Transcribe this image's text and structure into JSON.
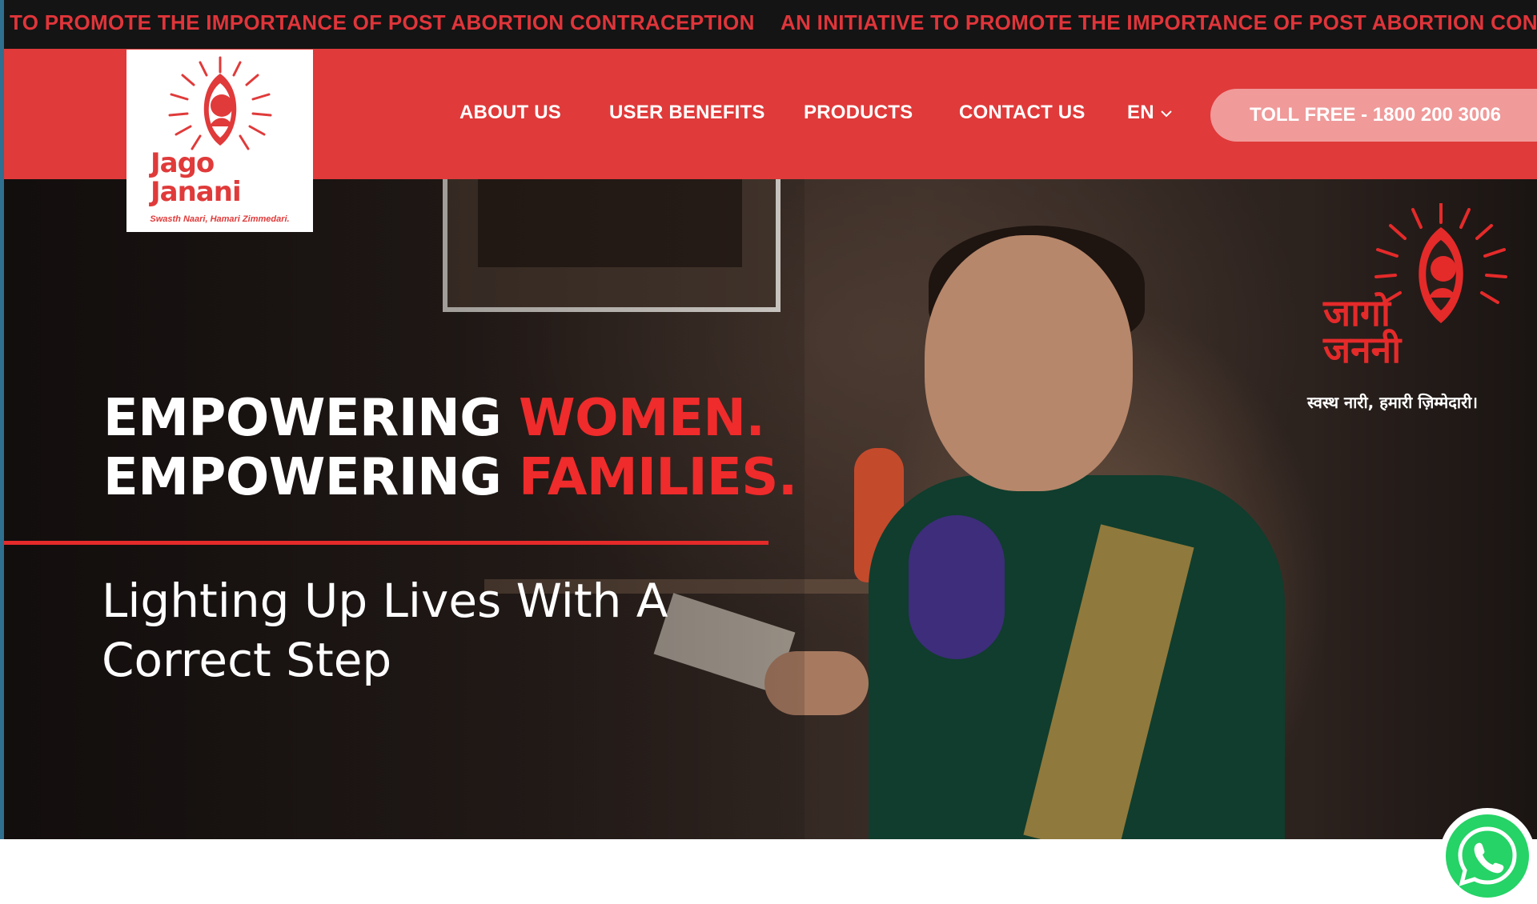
{
  "ticker": {
    "items": [
      "TO PROMOTE THE IMPORTANCE OF POST ABORTION CONTRACEPTION",
      "AN INITIATIVE TO PROMOTE THE IMPORTANCE OF POST ABORTION CONTR"
    ]
  },
  "logo": {
    "title_line1": "Jago",
    "title_line2": "Janani",
    "tagline": "Swasth Naari, Hamari Zimmedari."
  },
  "nav": {
    "items": [
      "ABOUT US",
      "USER BENEFITS",
      "PRODUCTS",
      "CONTACT US"
    ],
    "language": "EN",
    "toll_free": "TOLL FREE - 1800 200 3006"
  },
  "hero": {
    "line1_white": "EMPOWERING ",
    "line1_red": "WOMEN.",
    "line2_white": "EMPOWERING ",
    "line2_red": "FAMILIES.",
    "subline1": "Lighting Up Lives With A",
    "subline2": "Correct Step",
    "brand_hindi_line1": "जागो",
    "brand_hindi_line2": "जननी",
    "brand_hindi_tagline": "स्वस्थ नारी, हमारी ज़िम्मेदारी।"
  },
  "colors": {
    "brand_red": "#e03a3a",
    "ticker_bg": "#141414",
    "toll_pill": "#f09a9a",
    "whatsapp_green": "#25d366"
  },
  "icons": {
    "language_caret": "chevron-down-icon",
    "whatsapp": "whatsapp-icon",
    "logo_mark": "sun-eye-icon"
  }
}
